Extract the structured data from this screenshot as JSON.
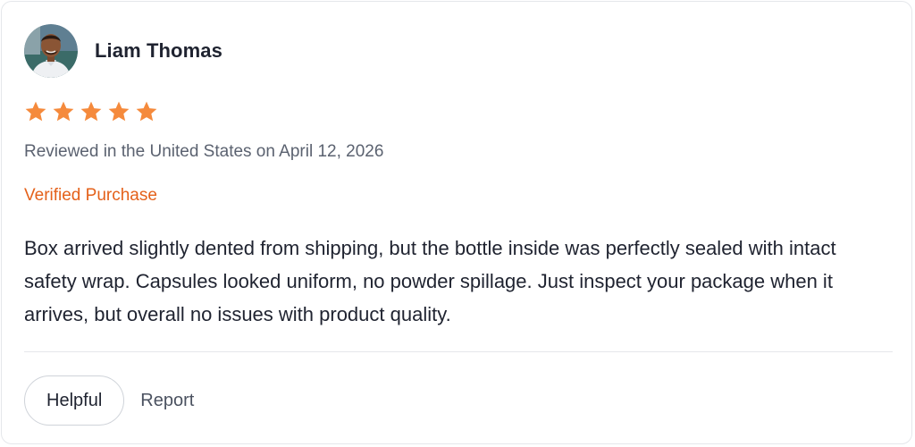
{
  "reviewer": {
    "name": "Liam Thomas",
    "avatar_icon": "reviewer-avatar-photo"
  },
  "rating": {
    "value": 5,
    "max": 5,
    "star_color": "#f58a3c"
  },
  "review": {
    "date_line": "Reviewed in the United States on April 12, 2026",
    "verified_label": "Verified Purchase",
    "verified_color": "#e4611a",
    "body": "Box arrived slightly dented from shipping, but the bottle inside was perfectly sealed with intact safety wrap. Capsules looked uniform, no powder spillage. Just inspect your package when it arrives, but overall no issues with product quality."
  },
  "actions": {
    "helpful_label": "Helpful",
    "report_label": "Report"
  }
}
